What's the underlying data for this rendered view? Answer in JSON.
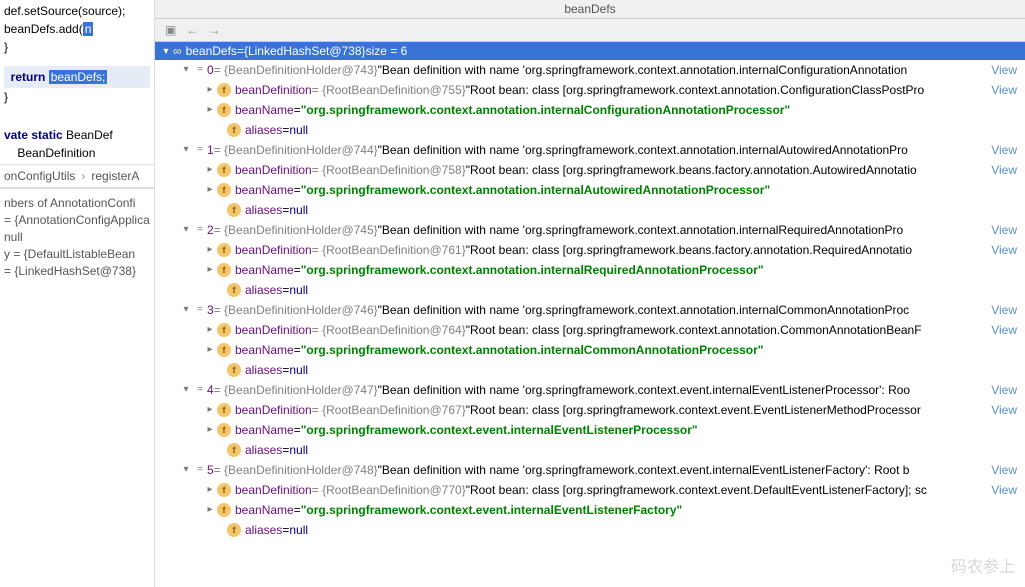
{
  "header": {
    "title": "beanDefs"
  },
  "code": {
    "l1": "def.setSource(source);",
    "l2_a": "beanDefs.add(",
    "l2_b": "n",
    "brace": "}",
    "return_kw": "return",
    "return_var": "beanDefs;",
    "decl_kw": "vate static",
    "decl_rest": " BeanDef",
    "decl2": "BeanDefinition"
  },
  "breadcrumb": {
    "a": "onConfigUtils",
    "b": "registerA"
  },
  "frames": {
    "l1": "nbers of AnnotationConfi",
    "l2": "= {AnnotationConfigApplica",
    "l3": "null",
    "l4": "y = {DefaultListableBean",
    "l5": "= {LinkedHashSet@738}"
  },
  "root": {
    "inf": "∞",
    "name": "beanDefs",
    "eq": " = ",
    "type": "{LinkedHashSet@738}",
    "size": "  size = 6"
  },
  "entries": [
    {
      "idx": "0",
      "holder": "{BeanDefinitionHolder@743}",
      "desc": " \"Bean definition with name 'org.springframework.context.annotation.internalConfigurationAnnotation",
      "bd_type": "{RootBeanDefinition@755}",
      "bd_val": " \"Root bean: class [org.springframework.context.annotation.ConfigurationClassPostPro",
      "beanName": "\"org.springframework.context.annotation.internalConfigurationAnnotationProcessor\"",
      "aliases": "null"
    },
    {
      "idx": "1",
      "holder": "{BeanDefinitionHolder@744}",
      "desc": " \"Bean definition with name 'org.springframework.context.annotation.internalAutowiredAnnotationPro",
      "bd_type": "{RootBeanDefinition@758}",
      "bd_val": " \"Root bean: class [org.springframework.beans.factory.annotation.AutowiredAnnotatio",
      "beanName": "\"org.springframework.context.annotation.internalAutowiredAnnotationProcessor\"",
      "aliases": "null"
    },
    {
      "idx": "2",
      "holder": "{BeanDefinitionHolder@745}",
      "desc": " \"Bean definition with name 'org.springframework.context.annotation.internalRequiredAnnotationPro",
      "bd_type": "{RootBeanDefinition@761}",
      "bd_val": " \"Root bean: class [org.springframework.beans.factory.annotation.RequiredAnnotatio",
      "beanName": "\"org.springframework.context.annotation.internalRequiredAnnotationProcessor\"",
      "aliases": "null"
    },
    {
      "idx": "3",
      "holder": "{BeanDefinitionHolder@746}",
      "desc": " \"Bean definition with name 'org.springframework.context.annotation.internalCommonAnnotationProc",
      "bd_type": "{RootBeanDefinition@764}",
      "bd_val": " \"Root bean: class [org.springframework.context.annotation.CommonAnnotationBeanF",
      "beanName": "\"org.springframework.context.annotation.internalCommonAnnotationProcessor\"",
      "aliases": "null"
    },
    {
      "idx": "4",
      "holder": "{BeanDefinitionHolder@747}",
      "desc": " \"Bean definition with name 'org.springframework.context.event.internalEventListenerProcessor': Roo",
      "bd_type": "{RootBeanDefinition@767}",
      "bd_val": " \"Root bean: class [org.springframework.context.event.EventListenerMethodProcessor",
      "beanName": "\"org.springframework.context.event.internalEventListenerProcessor\"",
      "aliases": "null"
    },
    {
      "idx": "5",
      "holder": "{BeanDefinitionHolder@748}",
      "desc": " \"Bean definition with name 'org.springframework.context.event.internalEventListenerFactory': Root b",
      "bd_type": "{RootBeanDefinition@770}",
      "bd_val": " \"Root bean: class [org.springframework.context.event.DefaultEventListenerFactory]; sc",
      "beanName": "\"org.springframework.context.event.internalEventListenerFactory\"",
      "aliases": "null"
    }
  ],
  "labels": {
    "view": "View",
    "beanDefinition": "beanDefinition",
    "beanName": "beanName",
    "aliases": "aliases",
    "eq": " = "
  },
  "watermark": "码农参上"
}
